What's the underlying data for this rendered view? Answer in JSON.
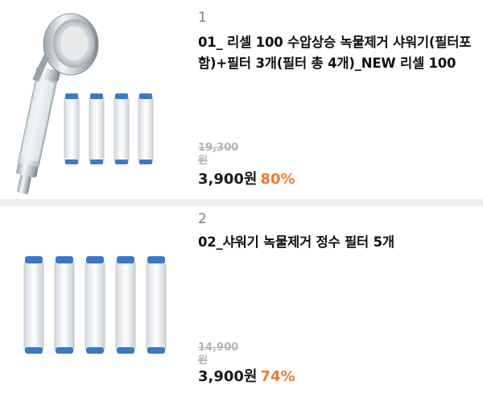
{
  "header": {
    "accent_color": "#f07a2a"
  },
  "products": [
    {
      "rank": "1",
      "title": "01_ 리셀 100 수압상승 녹물제거 샤워기(필터포함)+필터 3개(필터 총 4개)_NEW 리셀 100",
      "original_price": "19,300",
      "original_price_unit": "원",
      "sale_price": "3,900원",
      "discount": "80%",
      "image_icon": "shower-head-with-filters-image"
    },
    {
      "rank": "2",
      "title": "02_샤워기 녹물제거 정수 필터 5개",
      "original_price": "14,900",
      "original_price_unit": "원",
      "sale_price": "3,900원",
      "discount": "74%",
      "image_icon": "filter-cartridges-image"
    }
  ],
  "colors": {
    "discount": "#f07a2a",
    "filter_cap": "#3a78c9",
    "strike": "#b5b5b5"
  }
}
